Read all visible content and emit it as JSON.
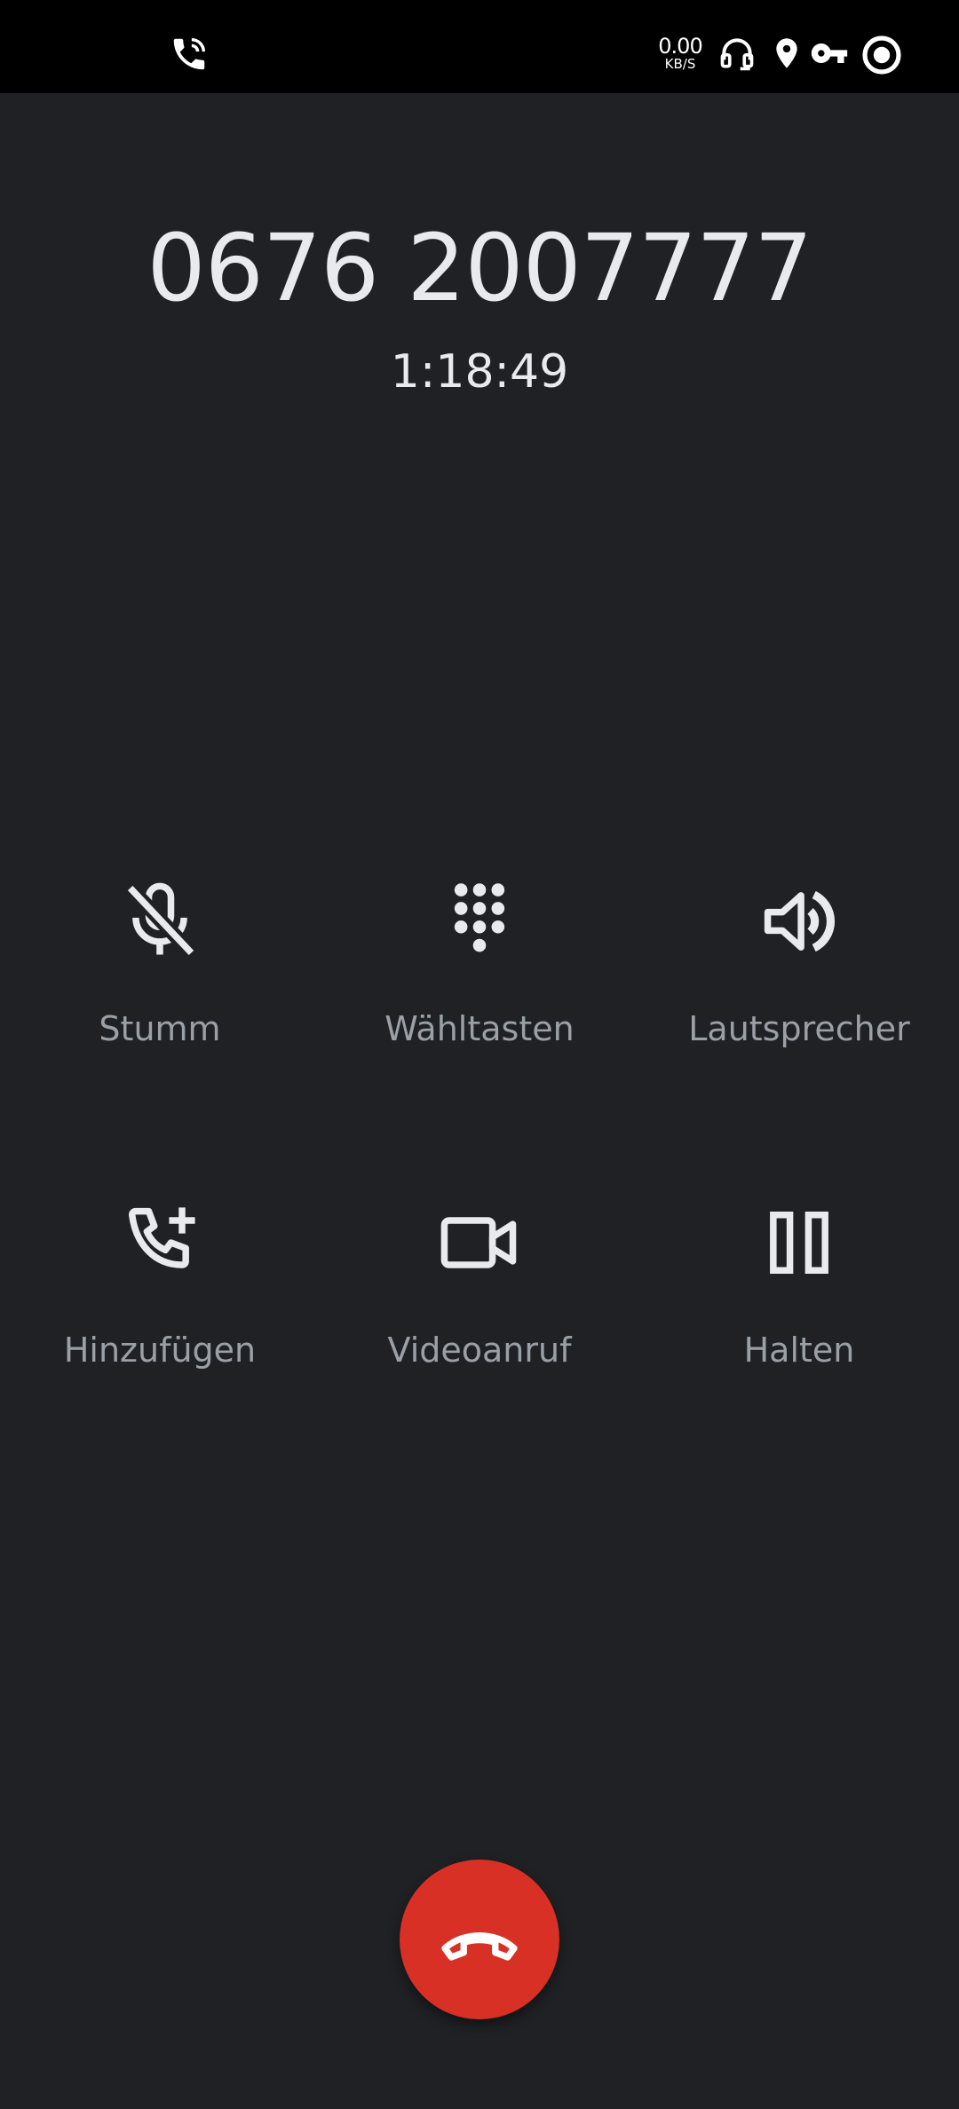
{
  "status_bar": {
    "net_speed_value": "0.00",
    "net_speed_unit": "KB/S",
    "icons": [
      "wifi-calling-icon",
      "headset-icon",
      "location-icon",
      "vpn-key-icon",
      "record-icon"
    ]
  },
  "call": {
    "number": "0676 2007777",
    "duration": "1:18:49"
  },
  "controls": {
    "mute": {
      "label": "Stumm",
      "icon": "mic-off-icon"
    },
    "keypad": {
      "label": "Wähltasten",
      "icon": "dialpad-icon"
    },
    "speaker": {
      "label": "Lautsprecher",
      "icon": "volume-icon"
    },
    "add_call": {
      "label": "Hinzufügen",
      "icon": "add-call-icon"
    },
    "video": {
      "label": "Videoanruf",
      "icon": "videocam-icon"
    },
    "hold": {
      "label": "Halten",
      "icon": "pause-icon"
    }
  },
  "end_call": {
    "icon": "call-end-icon",
    "color": "#d93025"
  },
  "colors": {
    "background": "#202124",
    "status_bar": "#000000",
    "text_primary": "#e8eaed",
    "text_secondary": "#9aa0a6"
  }
}
